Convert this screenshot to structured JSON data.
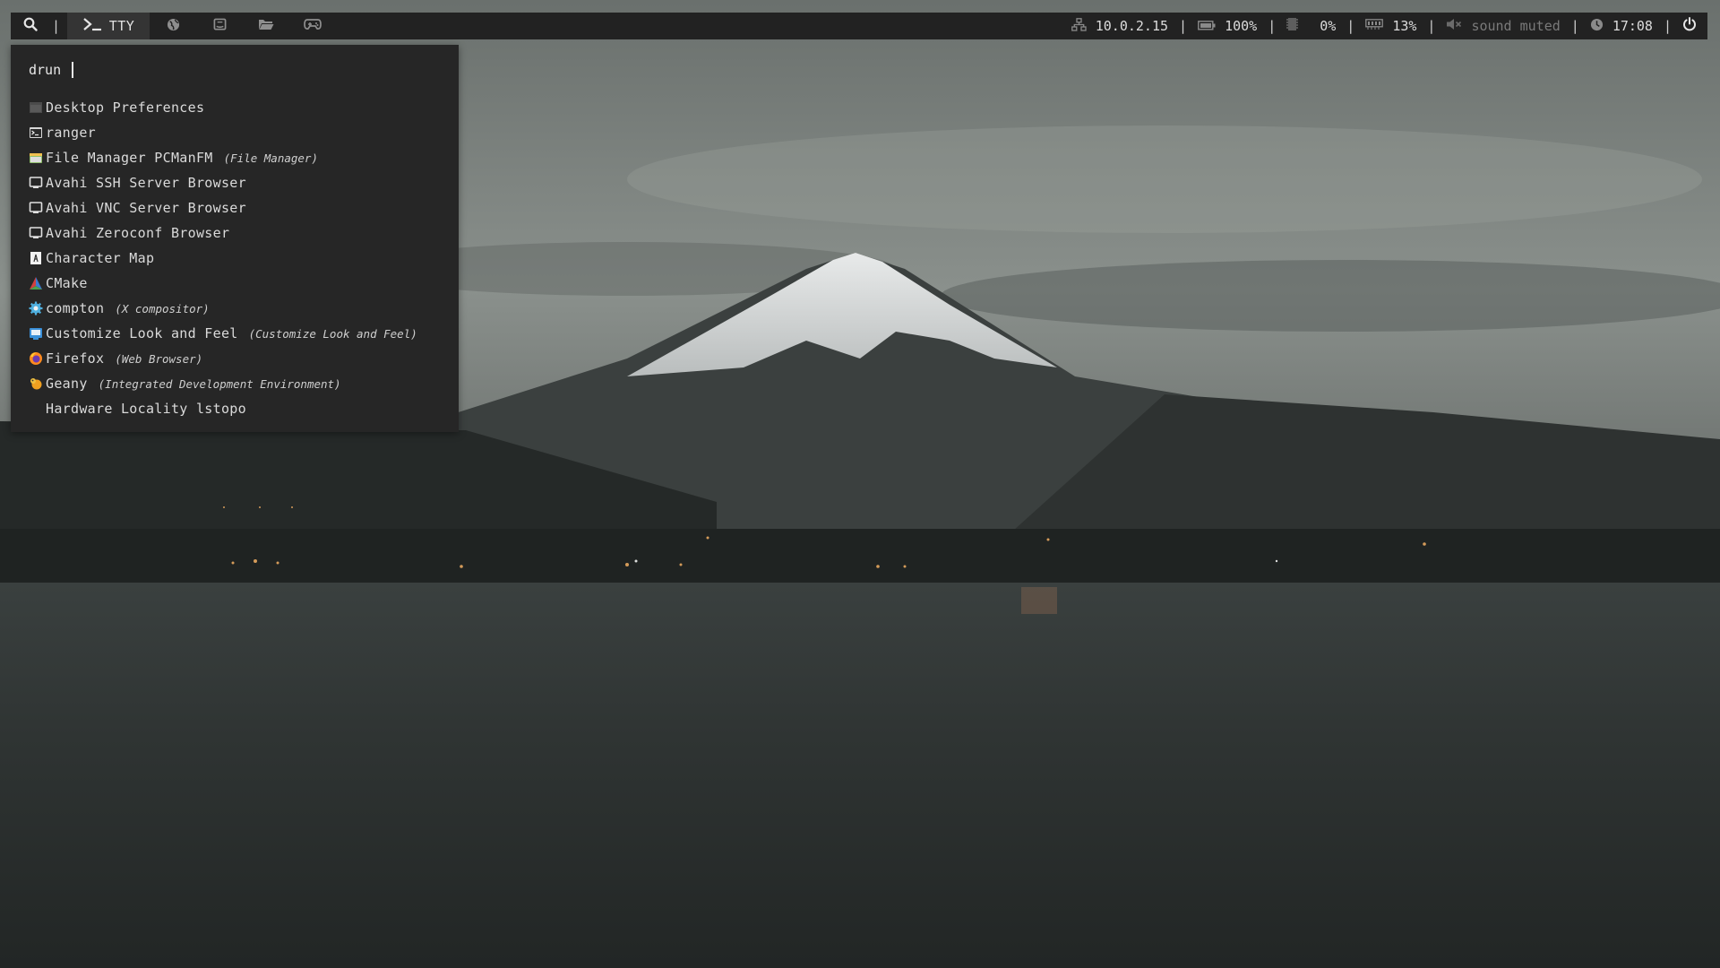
{
  "topbar": {
    "tty_label": "TTY",
    "search_separator": "|",
    "workspaces": [
      {
        "icon": "globe-icon"
      },
      {
        "icon": "chat-icon"
      },
      {
        "icon": "folder-icon"
      },
      {
        "icon": "gamepad-icon"
      }
    ],
    "status": {
      "ip": "10.0.2.15",
      "battery": "100%",
      "cpu": "0%",
      "memory": "13%",
      "sound": "sound muted",
      "time": "17:08"
    },
    "separator": "|"
  },
  "launcher": {
    "prompt": "drun",
    "entries": [
      {
        "name": "Desktop Preferences",
        "desc": "",
        "icon": "preferences-icon"
      },
      {
        "name": "ranger",
        "desc": "",
        "icon": "terminal-icon"
      },
      {
        "name": "File Manager PCManFM",
        "desc": "(File Manager)",
        "icon": "file-manager-icon"
      },
      {
        "name": "Avahi SSH Server Browser",
        "desc": "",
        "icon": "network-browser-icon"
      },
      {
        "name": "Avahi VNC Server Browser",
        "desc": "",
        "icon": "network-browser-icon"
      },
      {
        "name": "Avahi Zeroconf Browser",
        "desc": "",
        "icon": "network-browser-icon"
      },
      {
        "name": "Character Map",
        "desc": "",
        "icon": "character-map-icon"
      },
      {
        "name": "CMake",
        "desc": "",
        "icon": "cmake-icon"
      },
      {
        "name": "compton",
        "desc": "(X compositor)",
        "icon": "compton-gear-icon"
      },
      {
        "name": "Customize Look and Feel",
        "desc": "(Customize Look and Feel)",
        "icon": "appearance-icon"
      },
      {
        "name": "Firefox",
        "desc": "(Web Browser)",
        "icon": "firefox-icon"
      },
      {
        "name": "Geany",
        "desc": "(Integrated Development Environment)",
        "icon": "geany-icon"
      },
      {
        "name": "Hardware Locality lstopo",
        "desc": "",
        "icon": ""
      }
    ]
  },
  "colors": {
    "bar_bg": "#222222",
    "active_tab_bg": "#343434",
    "launcher_bg": "#262626",
    "text": "#d6d6d6",
    "muted_text": "#7a7a7a"
  }
}
